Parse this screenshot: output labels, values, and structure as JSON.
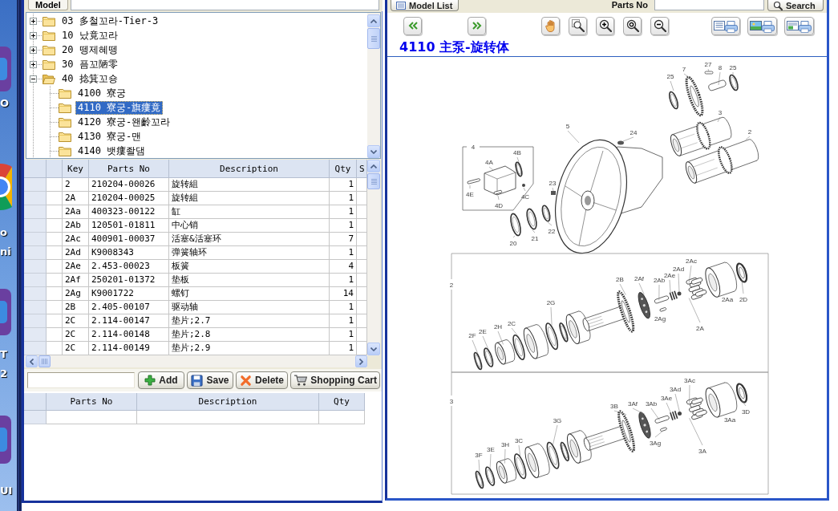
{
  "desktop": {
    "icon_labels": [
      "O",
      "o",
      "ni",
      "T",
      "2",
      "UI"
    ]
  },
  "left_panel": {
    "model_label": "Model",
    "tree": [
      {
        "label": "03 多철꼬라-Tier-3",
        "expanded": false,
        "selected": false
      },
      {
        "label": "10 났竟꼬라",
        "expanded": false,
        "selected": false
      },
      {
        "label": "20 뗑제혜뗑",
        "expanded": false,
        "selected": false
      },
      {
        "label": "30 픔꼬陋零",
        "expanded": false,
        "selected": false
      },
      {
        "label": "40 捻箕꼬숑",
        "expanded": true,
        "selected": false,
        "children": [
          {
            "label": "4100 寮궁",
            "selected": false
          },
          {
            "label": "4110 寮궁-旗瘻竟",
            "selected": true
          },
          {
            "label": "4120 寮궁-왠齡꼬라",
            "selected": false
          },
          {
            "label": "4130 寮궁-맨",
            "selected": false
          },
          {
            "label": "4140 뱃瘻좔댐",
            "selected": false
          }
        ]
      }
    ],
    "parts_table": {
      "columns": [
        "Key",
        "Parts No",
        "Description",
        "Qty",
        "S"
      ],
      "rows": [
        [
          "2",
          "210204-00026",
          "旋转組",
          "1"
        ],
        [
          "2A",
          "210204-00025",
          "旋转組",
          "1"
        ],
        [
          "2Aa",
          "400323-00122",
          "缸",
          "1"
        ],
        [
          "2Ab",
          "120501-01811",
          "中心销",
          "1"
        ],
        [
          "2Ac",
          "400901-00037",
          "活塞&活塞环",
          "7"
        ],
        [
          "2Ad",
          "K9008343",
          "弹簧轴环",
          "1"
        ],
        [
          "2Ae",
          "2.453-00023",
          "板簧",
          "4"
        ],
        [
          "2Af",
          "250201-01372",
          "垫板",
          "1"
        ],
        [
          "2Ag",
          "K9001722",
          "螺钉",
          "14"
        ],
        [
          "2B",
          "2.405-00107",
          "驱动轴",
          "1"
        ],
        [
          "2C",
          "2.114-00147",
          "垫片;2.7",
          "1"
        ],
        [
          "2C",
          "2.114-00148",
          "垫片;2.8",
          "1"
        ],
        [
          "2C",
          "2.114-00149",
          "垫片;2.9",
          "1"
        ]
      ]
    },
    "buttons": [
      "Add",
      "Save",
      "Delete",
      "Shopping Cart"
    ],
    "cart_table": {
      "columns": [
        "Parts No",
        "Description",
        "Qty"
      ]
    }
  },
  "right_panel": {
    "model_list_button": "Model List",
    "parts_no_label": "Parts No",
    "search_button": "Search",
    "title": "4110 主泵-旋转体",
    "diagram": {
      "panels": [
        {
          "kind": "housing",
          "callouts": [
            "25",
            "7",
            "27",
            "8",
            "25",
            "3",
            "5",
            "24",
            "2",
            "4",
            "4A",
            "4B",
            "23",
            "4E",
            "4D",
            "4C",
            "20",
            "21",
            "22"
          ]
        },
        {
          "kind": "rotary-group",
          "number": "2",
          "callouts": [
            "2Ac",
            "2Ad",
            "2B",
            "2Af",
            "2Ab",
            "2Ae",
            "2G",
            "2Aa",
            "2D",
            "2F",
            "2E",
            "2H",
            "2C",
            "2Ag",
            "2A"
          ]
        },
        {
          "kind": "rotary-group",
          "number": "3",
          "callouts": [
            "3Ac",
            "3Ad",
            "3B",
            "3Af",
            "3Ab",
            "3Ae",
            "3G",
            "3Aa",
            "3D",
            "3F",
            "3E",
            "3H",
            "3C",
            "3Ag",
            "3A"
          ]
        }
      ]
    }
  }
}
